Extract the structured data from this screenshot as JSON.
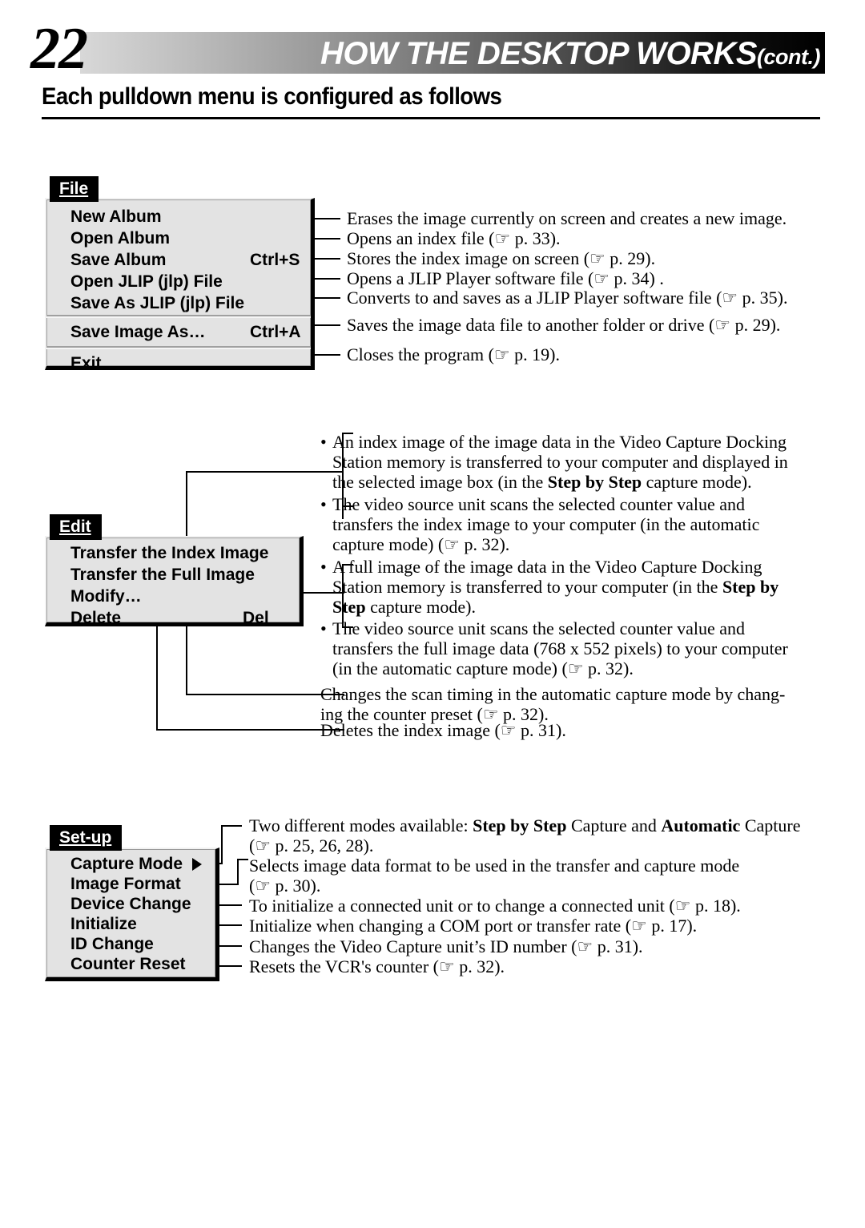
{
  "header": {
    "page_number": "22",
    "title": "HOW THE DESKTOP WORKS",
    "cont": "(cont.)",
    "subtitle": "Each pulldown menu is configured as follows"
  },
  "file_menu": {
    "tab_label_pre": "F",
    "tab_underlined": "",
    "tab_label": "File",
    "items": [
      {
        "label": "New Album",
        "accel": ""
      },
      {
        "label": "Open Album",
        "accel": ""
      },
      {
        "label": "Save Album",
        "accel": "Ctrl+S"
      },
      {
        "label": "Open JLIP (jlp) File",
        "accel": ""
      },
      {
        "label": "Save As JLIP (jlp) File",
        "accel": ""
      },
      {
        "label": "Save Image As…",
        "accel": "Ctrl+A"
      },
      {
        "label": "Exit",
        "accel": ""
      }
    ],
    "descriptions": [
      "Erases the image currently on screen and creates a new image.",
      "Opens an index file (☞ p. 33).",
      "Stores the index image on screen (☞ p. 29).",
      "Opens a JLIP Player software file (☞ p. 34) .",
      "Converts to and saves as a JLIP Player software file (☞ p. 35).",
      "Saves the image data file to another folder or drive (☞ p. 29).",
      "Closes the program (☞ p. 19)."
    ]
  },
  "edit_menu": {
    "tab_label": "Edit",
    "items": [
      {
        "label": "Transfer the Index Image",
        "accel": ""
      },
      {
        "label": "Transfer the Full Image",
        "accel": ""
      },
      {
        "label": "Modify…",
        "accel": ""
      },
      {
        "label": "Delete",
        "accel": "Del"
      }
    ],
    "descriptions": {
      "index_image_b1_l1": "An index image of the image data in the Video Capture Docking",
      "index_image_b1_l2": "Station memory is transferred to your computer and displayed in",
      "index_image_b1_l3a": "the selected image box (in the ",
      "index_image_b1_l3b": "Step by Step",
      "index_image_b1_l3c": " capture mode).",
      "index_image_b2_l1": "The video source unit scans the selected counter value and",
      "index_image_b2_l2": "transfers the index image to your computer (in the automatic",
      "index_image_b2_l3": "capture mode) (☞ p. 32).",
      "full_image_b1_l1": "A full image of the image data in the Video Capture Docking",
      "full_image_b1_l2a": "Station memory is transferred to your computer (in the ",
      "full_image_b1_l2b": "Step by",
      "full_image_b1_l3a": "Step",
      "full_image_b1_l3b": " capture mode).",
      "full_image_b2_l1": "The video source unit scans the selected counter value and",
      "full_image_b2_l2": "transfers the full image data (768 x 552 pixels) to your computer",
      "full_image_b2_l3": "(in the automatic capture mode) (☞ p. 32).",
      "modify_l1": "Changes the scan timing in the automatic capture mode by chang-",
      "modify_l2": "ing the counter preset (☞ p. 32).",
      "delete_l1": "Deletes the index image (☞ p. 31)."
    }
  },
  "setup_menu": {
    "tab_label": "Set-up",
    "items": [
      {
        "label": "Capture Mode",
        "submenu": true
      },
      {
        "label": "Image Format",
        "submenu": false
      },
      {
        "label": "Device Change",
        "submenu": false
      },
      {
        "label": "Initialize",
        "submenu": false
      },
      {
        "label": "ID Change",
        "submenu": false
      },
      {
        "label": "Counter Reset",
        "submenu": false
      }
    ],
    "descriptions": {
      "capture_mode_l1a": "Two different modes available: ",
      "capture_mode_l1b": "Step by Step",
      "capture_mode_l1c": " Capture and ",
      "capture_mode_l1d": "Automatic",
      "capture_mode_l1e": " Capture",
      "capture_mode_l2": "(☞ p. 25, 26, 28).",
      "image_format_l1": "Selects image data format to be used in the transfer and capture mode",
      "image_format_l2": "(☞ p. 30).",
      "device_change": "To initialize a connected unit or to change a connected unit (☞ p. 18).",
      "initialize": "Initialize when changing a COM port or transfer rate (☞ p. 17).",
      "id_change": "Changes the Video Capture unit’s ID number (☞ p. 31).",
      "counter_reset": "Resets the VCR's counter (☞ p. 32)."
    }
  }
}
